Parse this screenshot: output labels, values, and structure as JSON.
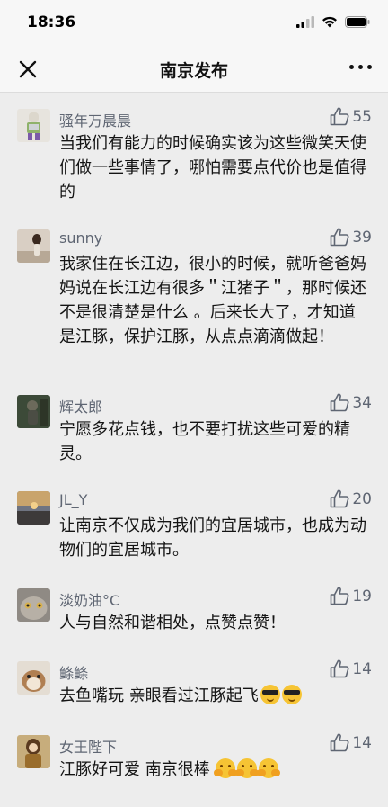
{
  "status_bar": {
    "time": "18:36"
  },
  "nav": {
    "title": "南京发布"
  },
  "colors": {
    "background": "#ededed",
    "bar": "#f7f7f7",
    "meta_text": "#5f6673",
    "body_text": "#141414"
  },
  "comments": [
    {
      "name": "骚年万晨晨",
      "likes": "55",
      "text": "当我们有能力的时候确实该为这些微笑天使们做一些事情了，哪怕需要点代价也是值得的"
    },
    {
      "name": "sunny",
      "likes": "39",
      "text": "我家住在长江边，很小的时候，就听爸爸妈妈说在长江边有很多＂江猪子＂，那时候还不是很清楚是什么 。后来长大了，才知道是江豚，保护江豚，从点点滴滴做起！"
    },
    {
      "name": "辉太郎",
      "likes": "34",
      "text": "宁愿多花点钱，也不要打扰这些可爱的精灵。"
    },
    {
      "name": "JL_Y",
      "likes": "20",
      "text": "让南京不仅成为我们的宜居城市，也成为动物们的宜居城市。"
    },
    {
      "name": "淡奶油°C",
      "likes": "19",
      "text": "人与自然和谐相处，点赞点赞！"
    },
    {
      "name": "鲦鲦",
      "likes": "14",
      "text": "去鱼嘴玩 亲眼看过江豚起飞"
    },
    {
      "name": "女王陛下",
      "likes": "14",
      "text": "江豚好可爱 南京很棒"
    }
  ]
}
